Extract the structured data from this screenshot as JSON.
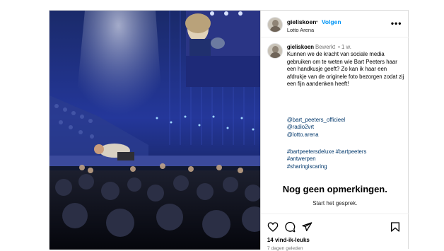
{
  "post": {
    "username": "gieliskoen",
    "separator": "•",
    "follow_label": "Volgen",
    "location": "Lotto Arena",
    "more_icon": "more-horizontal-icon",
    "more_label": "•••"
  },
  "caption": {
    "username": "gieliskoen",
    "edited": "Bewerkt",
    "time": "•  1 w.",
    "text": "Kunnen we de kracht van sociale media gebruiken om te weten wie Bart Peeters haar een handkusje geeft? Zo kan ik haar een afdrukje van de originele foto bezorgen zodat zij een fijn aandenken heeft!",
    "mentions": [
      "@bart_peeters_officieel",
      "@radio2vrt",
      "@lotto.arena"
    ],
    "hashtags_line1": [
      "#bartpeetersdeluxe",
      "#bartpeeters"
    ],
    "hashtags_rest": [
      "#antwerpen",
      "#sharingiscaring"
    ]
  },
  "comments": {
    "empty_title": "Nog geen opmerkingen.",
    "empty_subtitle": "Start het gesprek."
  },
  "actions": {
    "like_icon": "heart-icon",
    "comment_icon": "comment-icon",
    "share_icon": "share-icon",
    "save_icon": "bookmark-icon",
    "likes": "14 vind-ik-leuks",
    "date": "7 dagen geleden"
  },
  "colors": {
    "link": "#00376b",
    "follow": "#0095f6",
    "muted": "#737373",
    "stage_blue": "#2b3fa8"
  }
}
